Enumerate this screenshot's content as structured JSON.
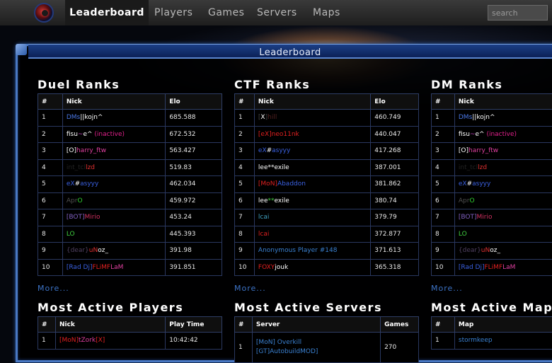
{
  "nav": {
    "items": [
      "Leaderboard",
      "Players",
      "Games",
      "Servers",
      "Maps"
    ],
    "search_placeholder": "search"
  },
  "panel": {
    "title": "Leaderboard"
  },
  "duel": {
    "title": "Duel Ranks",
    "headers": [
      "#",
      "Nick",
      "Elo"
    ],
    "rows": [
      {
        "rank": "1",
        "nick": [
          {
            "t": "DMs",
            "c": "#4a78e8"
          },
          {
            "t": "||",
            "c": "#ffffff"
          },
          {
            "t": "kojn^",
            "c": "#ffffff"
          }
        ],
        "elo": "685.588"
      },
      {
        "rank": "2",
        "nick": [
          {
            "t": "fisu",
            "c": "#ffffff"
          },
          {
            "t": "~",
            "c": "#c040c0"
          },
          {
            "t": "e^ ",
            "c": "#ffffff"
          },
          {
            "t": "(inactive)",
            "c": "#e0208a"
          }
        ],
        "elo": "672.532"
      },
      {
        "rank": "3",
        "nick": [
          {
            "t": "[O]",
            "c": "#ffffff"
          },
          {
            "t": "harry_ftw",
            "c": "#e040a0"
          }
        ],
        "elo": "563.427"
      },
      {
        "rank": "4",
        "nick": [
          {
            "t": "int_tcl",
            "c": "#222222"
          },
          {
            "t": "lzd",
            "c": "#e03030"
          }
        ],
        "elo": "519.83"
      },
      {
        "rank": "5",
        "nick": [
          {
            "t": "eX",
            "c": "#3a60e0"
          },
          {
            "t": "#",
            "c": "#ffffff"
          },
          {
            "t": "asyyy",
            "c": "#3a60e0"
          }
        ],
        "elo": "462.034"
      },
      {
        "rank": "6",
        "nick": [
          {
            "t": "Apr",
            "c": "#505050"
          },
          {
            "t": "O",
            "c": "#30d030"
          }
        ],
        "elo": "459.972"
      },
      {
        "rank": "7",
        "nick": [
          {
            "t": "[BOT]",
            "c": "#8060c0"
          },
          {
            "t": "Mirio",
            "c": "#d03060"
          }
        ],
        "elo": "453.24"
      },
      {
        "rank": "8",
        "nick": [
          {
            "t": "LO",
            "c": "#40d040"
          }
        ],
        "elo": "445.393"
      },
      {
        "rank": "9",
        "nick": [
          {
            "t": "{dear}",
            "c": "#504060"
          },
          {
            "t": "uN",
            "c": "#e03030"
          },
          {
            "t": "oz_",
            "c": "#ffffff"
          }
        ],
        "elo": "391.98"
      },
      {
        "rank": "10",
        "nick": [
          {
            "t": "[Rad Dj]",
            "c": "#3a60e0"
          },
          {
            "t": "FLiMF",
            "c": "#e02020"
          },
          {
            "t": "LaM",
            "c": "#e040a0"
          }
        ],
        "elo": "391.851"
      }
    ],
    "more": "More..."
  },
  "ctf": {
    "title": "CTF Ranks",
    "headers": [
      "#",
      "Nick",
      "Elo"
    ],
    "rows": [
      {
        "rank": "1",
        "nick": [
          {
            "t": "[",
            "c": "#444444"
          },
          {
            "t": "X",
            "c": "#ffffff"
          },
          {
            "t": "]",
            "c": "#444444"
          },
          {
            "t": "hill",
            "c": "#502020"
          }
        ],
        "elo": "460.749"
      },
      {
        "rank": "2",
        "nick": [
          {
            "t": "[eX]",
            "c": "#e02020"
          },
          {
            "t": "neo11nk",
            "c": "#e02020"
          }
        ],
        "elo": "440.047"
      },
      {
        "rank": "3",
        "nick": [
          {
            "t": "eX",
            "c": "#3a60e0"
          },
          {
            "t": "#",
            "c": "#ffffff"
          },
          {
            "t": "asyyy",
            "c": "#3a60e0"
          }
        ],
        "elo": "417.268"
      },
      {
        "rank": "4",
        "nick": [
          {
            "t": "lee**exile",
            "c": "#ffffff"
          }
        ],
        "elo": "387.001"
      },
      {
        "rank": "5",
        "nick": [
          {
            "t": "[MoN]",
            "c": "#e02020"
          },
          {
            "t": "Abaddon",
            "c": "#3a60e0"
          }
        ],
        "elo": "381.862"
      },
      {
        "rank": "6",
        "nick": [
          {
            "t": "lee",
            "c": "#ffffff"
          },
          {
            "t": "**",
            "c": "#40d040"
          },
          {
            "t": "exile",
            "c": "#ffffff"
          }
        ],
        "elo": "380.74"
      },
      {
        "rank": "7",
        "nick": [
          {
            "t": "lcai",
            "c": "#40a0c0"
          }
        ],
        "elo": "379.79"
      },
      {
        "rank": "8",
        "nick": [
          {
            "t": "lcai",
            "c": "#e02020"
          }
        ],
        "elo": "372.877"
      },
      {
        "rank": "9",
        "nick": [
          {
            "t": "Anonymous Player #148",
            "c": "#3a80d0"
          }
        ],
        "elo": "371.613"
      },
      {
        "rank": "10",
        "nick": [
          {
            "t": "FOXY",
            "c": "#e02020"
          },
          {
            "t": "jouk",
            "c": "#ffffff"
          }
        ],
        "elo": "365.318"
      }
    ],
    "more": "More..."
  },
  "dm": {
    "title": "DM Ranks",
    "headers": [
      "#",
      "Nick"
    ],
    "rows": [
      {
        "rank": "1",
        "nick": [
          {
            "t": "DMs",
            "c": "#4a78e8"
          },
          {
            "t": "||",
            "c": "#ffffff"
          },
          {
            "t": "kojn^",
            "c": "#ffffff"
          }
        ]
      },
      {
        "rank": "2",
        "nick": [
          {
            "t": "fisu",
            "c": "#ffffff"
          },
          {
            "t": "~",
            "c": "#c040c0"
          },
          {
            "t": "e^ ",
            "c": "#ffffff"
          },
          {
            "t": "(inactive)",
            "c": "#e0208a"
          }
        ]
      },
      {
        "rank": "3",
        "nick": [
          {
            "t": "[O]",
            "c": "#ffffff"
          },
          {
            "t": "harry_ftw",
            "c": "#e040a0"
          }
        ]
      },
      {
        "rank": "4",
        "nick": [
          {
            "t": "int_tcl",
            "c": "#222222"
          },
          {
            "t": "lzd",
            "c": "#e03030"
          }
        ]
      },
      {
        "rank": "5",
        "nick": [
          {
            "t": "eX",
            "c": "#3a60e0"
          },
          {
            "t": "#",
            "c": "#ffffff"
          },
          {
            "t": "asyyy",
            "c": "#3a60e0"
          }
        ]
      },
      {
        "rank": "6",
        "nick": [
          {
            "t": "Apr",
            "c": "#505050"
          },
          {
            "t": "O",
            "c": "#30d030"
          }
        ]
      },
      {
        "rank": "7",
        "nick": [
          {
            "t": "[BOT]",
            "c": "#8060c0"
          },
          {
            "t": "Mirio",
            "c": "#d03060"
          }
        ]
      },
      {
        "rank": "8",
        "nick": [
          {
            "t": "LO",
            "c": "#40d040"
          }
        ]
      },
      {
        "rank": "9",
        "nick": [
          {
            "t": "{dear}",
            "c": "#504060"
          },
          {
            "t": "uN",
            "c": "#e03030"
          },
          {
            "t": "oz_",
            "c": "#ffffff"
          }
        ]
      },
      {
        "rank": "10",
        "nick": [
          {
            "t": "[Rad Dj]",
            "c": "#3a60e0"
          },
          {
            "t": "FLiMF",
            "c": "#e02020"
          },
          {
            "t": "LaM",
            "c": "#e040a0"
          }
        ]
      }
    ],
    "more": "More..."
  },
  "active_players": {
    "title": "Most Active Players",
    "headers": [
      "#",
      "Nick",
      "Play Time"
    ],
    "rows": [
      {
        "rank": "1",
        "nick": [
          {
            "t": "[MoN]",
            "c": "#e02020"
          },
          {
            "t": "tZork",
            "c": "#e040a0"
          },
          {
            "t": "[X]",
            "c": "#e02020"
          }
        ],
        "value": "10:42:42"
      }
    ]
  },
  "active_servers": {
    "title": "Most Active Servers",
    "headers": [
      "#",
      "Server",
      "Games"
    ],
    "rows": [
      {
        "rank": "1",
        "nick": [
          {
            "t": "[MoN] Overkill",
            "c": "#3a80d0"
          },
          {
            "t": "\n",
            "c": "#ffffff"
          },
          {
            "t": "[GT]AutobuildMOD]",
            "c": "#3a80d0"
          }
        ],
        "value": "270"
      }
    ]
  },
  "active_maps": {
    "title": "Most Active Maps",
    "headers": [
      "#",
      "Map"
    ],
    "rows": [
      {
        "rank": "1",
        "nick": [
          {
            "t": "stormkeep",
            "c": "#3a80d0"
          }
        ]
      }
    ]
  }
}
